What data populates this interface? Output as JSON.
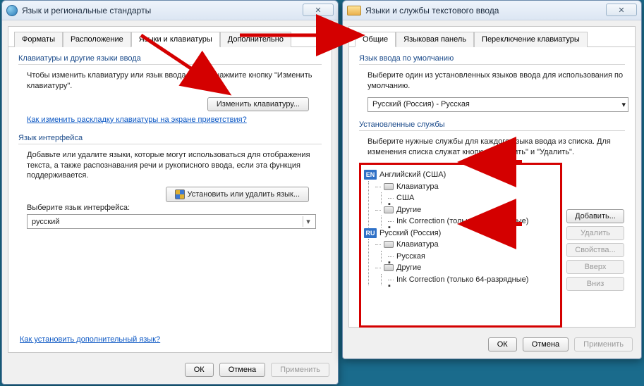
{
  "left": {
    "title": "Язык и региональные стандарты",
    "tabs": [
      "Форматы",
      "Расположение",
      "Языки и клавиатуры",
      "Дополнительно"
    ],
    "active_tab": 2,
    "group1": {
      "label": "Клавиатуры и другие языки ввода",
      "desc": "Чтобы изменить клавиатуру или язык ввода текста, нажмите кнопку \"Изменить клавиатуру\".",
      "button": "Изменить клавиатуру...",
      "link": "Как изменить раскладку клавиатуры на экране приветствия?"
    },
    "group2": {
      "label": "Язык интерфейса",
      "desc": "Добавьте или удалите языки, которые могут использоваться для отображения текста, а также распознавания речи и рукописного ввода, если эта функция поддерживается.",
      "button": "Установить или удалить язык...",
      "select_label": "Выберите язык интерфейса:",
      "select_value": "русский"
    },
    "bottom_link": "Как установить дополнительный язык?",
    "buttons": {
      "ok": "ОК",
      "cancel": "Отмена",
      "apply": "Применить"
    }
  },
  "right": {
    "title": "Языки и службы текстового ввода",
    "tabs": [
      "Общие",
      "Языковая панель",
      "Переключение клавиатуры"
    ],
    "active_tab": 0,
    "group1": {
      "label": "Язык ввода по умолчанию",
      "desc": "Выберите один из установленных языков ввода для использования по умолчанию.",
      "value": "Русский (Россия) - Русская"
    },
    "group2": {
      "label": "Установленные службы",
      "desc": "Выберите нужные службы для каждого языка ввода из списка. Для изменения списка служат кнопки \"Добавить\" и \"Удалить\".",
      "langs": [
        {
          "badge": "EN",
          "name": "Английский (США)",
          "kb_label": "Клавиатура",
          "kb_items": [
            "США"
          ],
          "other_label": "Другие",
          "other_items": [
            "Ink Correction (только 64-разрядные)"
          ]
        },
        {
          "badge": "RU",
          "name": "Русский (Россия)",
          "kb_label": "Клавиатура",
          "kb_items": [
            "Русская"
          ],
          "other_label": "Другие",
          "other_items": [
            "Ink Correction (только 64-разрядные)"
          ]
        }
      ],
      "side": {
        "add": "Добавить...",
        "remove": "Удалить",
        "props": "Свойства...",
        "up": "Вверх",
        "down": "Вниз"
      }
    },
    "buttons": {
      "ok": "ОК",
      "cancel": "Отмена",
      "apply": "Применить"
    }
  }
}
